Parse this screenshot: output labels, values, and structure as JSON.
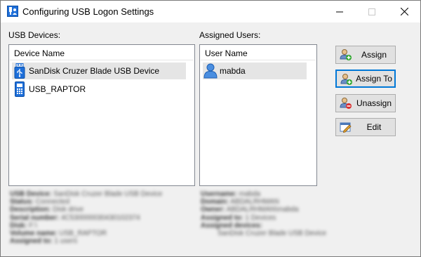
{
  "window": {
    "title": "Configuring USB Logon Settings",
    "controls": {
      "minimize": "—",
      "maximize": "☐",
      "close": "✕"
    }
  },
  "devices": {
    "section_label": "USB Devices:",
    "column_header": "Device Name",
    "items": [
      {
        "label": "SanDisk Cruzer Blade USB Device",
        "icon": "usb-drive-icon",
        "selected": true
      },
      {
        "label": "USB_RAPTOR",
        "icon": "usb-device-icon",
        "selected": false
      }
    ]
  },
  "users": {
    "section_label": "Assigned Users:",
    "column_header": "User Name",
    "items": [
      {
        "label": "mabda",
        "icon": "user-icon",
        "selected": true
      }
    ]
  },
  "buttons": {
    "assign": "Assign",
    "assign_to": "Assign To",
    "unassign": "Unassign",
    "edit": "Edit"
  },
  "device_details": [
    {
      "key": "USB Device:",
      "value": "SanDisk Cruzer Blade USB Device"
    },
    {
      "key": "Status:",
      "value": "Connected"
    },
    {
      "key": "Description:",
      "value": "Disk drive"
    },
    {
      "key": "Serial number:",
      "value": "4C530000030430102374"
    },
    {
      "key": "Disk:",
      "value": "F:\\"
    },
    {
      "key": "Volume name:",
      "value": "USB_RAPTOR"
    },
    {
      "key": "Assigned to:",
      "value": "1 users"
    }
  ],
  "user_details": [
    {
      "key": "Username:",
      "value": "mabda"
    },
    {
      "key": "Domain:",
      "value": "ABDALRHMAN"
    },
    {
      "key": "Owner:",
      "value": "ABDALRHMAN\\mabda"
    },
    {
      "key": "Assigned to:",
      "value": "1 Devices"
    },
    {
      "key": "Assigned devices:",
      "value": ""
    },
    {
      "key": "",
      "value": "SanDisk Cruzer Blade USB Device"
    }
  ],
  "colors": {
    "accent": "#0078d7",
    "selection": "#e5e5e5",
    "icon_blue": "#1e6fd9"
  }
}
